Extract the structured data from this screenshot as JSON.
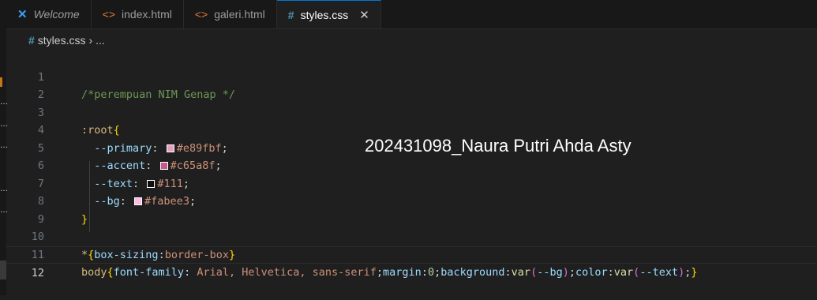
{
  "tabs": [
    {
      "label": "Welcome",
      "icon": "vscode-logo-icon",
      "active": false
    },
    {
      "label": "index.html",
      "icon": "html-file-icon",
      "active": false
    },
    {
      "label": "galeri.html",
      "icon": "html-file-icon",
      "active": false
    },
    {
      "label": "styles.css",
      "icon": "css-file-icon",
      "active": true,
      "close": "✕"
    }
  ],
  "breadcrumb": {
    "file": "styles.css",
    "separator": "›",
    "rest": "..."
  },
  "code": {
    "line1_comment": "/*perempuan NIM Genap */",
    "root_selector": ":root",
    "open_brace": "{",
    "close_brace": "}",
    "vars": [
      {
        "name": "--primary",
        "value": "#e89fbf",
        "swatch": "#e89fbf"
      },
      {
        "name": "--accent",
        "value": "#c65a8f",
        "swatch": "#c65a8f"
      },
      {
        "name": "--text",
        "value": "#111",
        "swatch": "#111111"
      },
      {
        "name": "--bg",
        "value": "#fabee3",
        "swatch": "#fabee3"
      }
    ],
    "star_selector": "*",
    "box_sizing_prop": "box-sizing",
    "box_sizing_val": "border-box",
    "body_selector": "body",
    "font_family_prop": "font-family",
    "font_family_val": " Arial, Helvetica, sans-serif",
    "margin_prop": "margin",
    "margin_val": "0",
    "background_prop": "background",
    "color_prop": "color",
    "var_fn": "var",
    "bg_var": "--bg",
    "text_var": "--text"
  },
  "line_numbers": [
    "1",
    "2",
    "3",
    "4",
    "5",
    "6",
    "7",
    "8",
    "9",
    "10",
    "11",
    "12"
  ],
  "current_line": "12",
  "overlay_text": "202431098_Naura Putri Ahda Asty"
}
